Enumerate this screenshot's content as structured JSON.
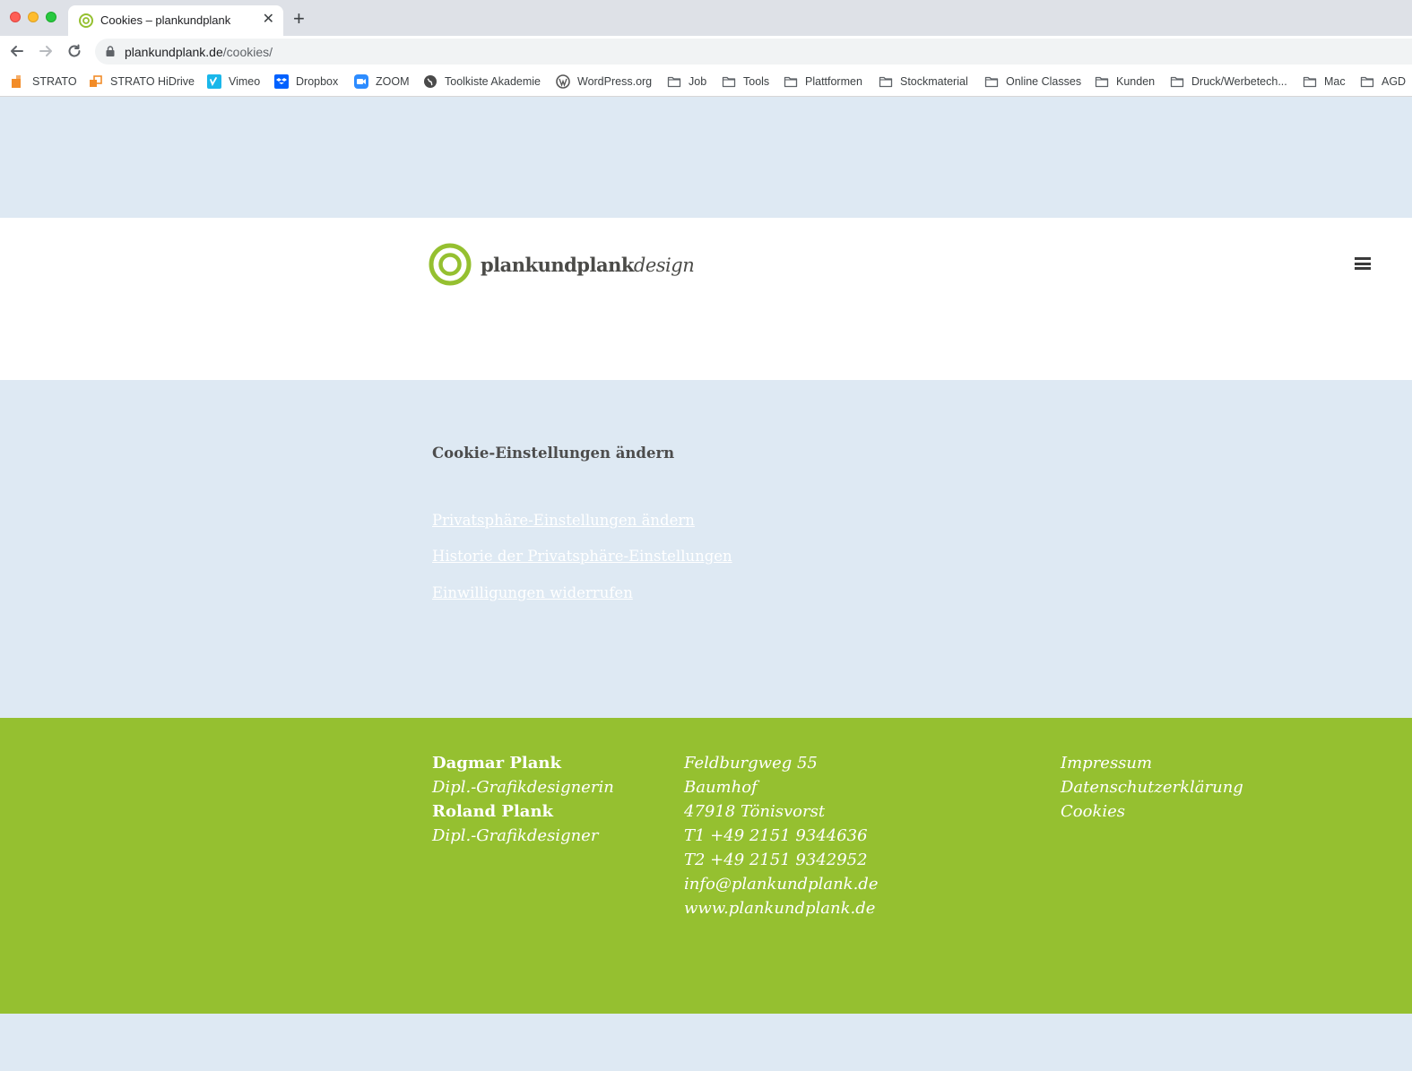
{
  "browser": {
    "tab_title": "Cookies – plankundplank",
    "url_host": "plankundplank.de",
    "url_path": "/cookies/",
    "bookmarks": [
      {
        "label": "STRATO",
        "icon": "strato-icon"
      },
      {
        "label": "STRATO HiDrive",
        "icon": "hidrive-icon"
      },
      {
        "label": "Vimeo",
        "icon": "vimeo-icon"
      },
      {
        "label": "Dropbox",
        "icon": "dropbox-icon"
      },
      {
        "label": "ZOOM",
        "icon": "zoom-icon"
      },
      {
        "label": "Toolkiste Akademie",
        "icon": "globe-icon"
      },
      {
        "label": "WordPress.org",
        "icon": "wordpress-icon"
      },
      {
        "label": "Job",
        "icon": "folder-icon"
      },
      {
        "label": "Tools",
        "icon": "folder-icon"
      },
      {
        "label": "Plattformen",
        "icon": "folder-icon"
      },
      {
        "label": "Stockmaterial",
        "icon": "folder-icon"
      },
      {
        "label": "Online Classes",
        "icon": "folder-icon"
      },
      {
        "label": "Kunden",
        "icon": "folder-icon"
      },
      {
        "label": "Druck/Werbetech...",
        "icon": "folder-icon"
      },
      {
        "label": "Mac",
        "icon": "folder-icon"
      },
      {
        "label": "AGD",
        "icon": "folder-icon"
      }
    ]
  },
  "header": {
    "logo_bold": "plankundplank",
    "logo_italic": "design"
  },
  "content": {
    "heading": "Cookie-Einstellungen ändern",
    "links": [
      "Privatsphäre-Einstellungen ändern",
      "Historie der Privatsphäre-Einstellungen",
      "Einwilligungen widerrufen"
    ]
  },
  "footer": {
    "col1": {
      "name1": "Dagmar Plank",
      "title1": "Dipl.-Grafikdesignerin",
      "name2": "Roland Plank",
      "title2": "Dipl.-Grafikdesigner"
    },
    "col2": {
      "street": "Feldburgweg 55",
      "place": "Baumhof",
      "city": "47918 Tönisvorst",
      "phone1": "T1 +49 2151 9344636",
      "phone2": "T2  +49 2151 9342952",
      "email": "info@plankundplank.de",
      "web": "www.plankundplank.de"
    },
    "col3": {
      "impressum": "Impressum",
      "datenschutz": "Datenschutzerklärung",
      "cookies": "Cookies"
    }
  },
  "colors": {
    "brand_green": "#95c030",
    "page_bg": "#dee9f3",
    "text_dark": "#4d4d4d"
  }
}
